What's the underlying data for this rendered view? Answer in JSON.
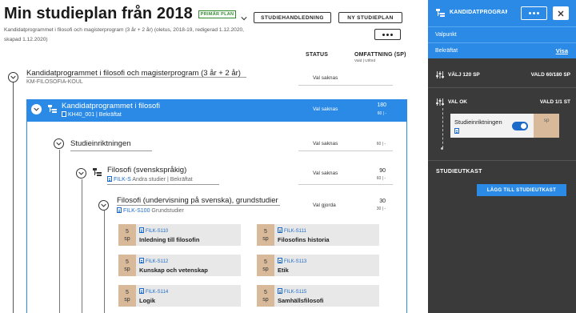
{
  "header": {
    "title": "Min studieplan från 2018",
    "badge": "PRIMÄR PLAN",
    "subtitle": "Kandidatprogrammet i filosofi och magisterprogram (3 år + 2 år) (oletus, 2018-19, redigerad 1.12.2020, skapad 1.12.2020)",
    "btn_guide": "STUDIEHANDLEDNING",
    "btn_new": "NY STUDIEPLAN"
  },
  "columns": {
    "status": "STATUS",
    "scope": "OMFATTNING (SP)",
    "scope_sub": "Vald | Utförd"
  },
  "tree": {
    "root": {
      "title": "Kandidatprogrammet i filosofi och magisterprogram (3 år + 2 år)",
      "code": "KM-FILOSOFIA-KOUL",
      "status": "Val saknas"
    },
    "prog": {
      "title": "Kandidatprogrammet i filosofi",
      "code": "KH40_001 | Bekräftat",
      "status": "Val saknas",
      "credits": "180",
      "credits_sub": "60 | -"
    },
    "line": {
      "title": "Studieinriktningen",
      "status": "Val saknas",
      "credits_sub": "60 | -"
    },
    "sub": {
      "title": "Filosofi (svenskspråkig)",
      "code": "FILK-S",
      "code_rest": "Andra studier | Bekräftat",
      "status": "Val saknas",
      "credits": "90",
      "credits_sub": "60 | -"
    },
    "basic": {
      "title": "Filosofi (undervisning på svenska), grundstudier",
      "code": "FILK-S100",
      "code_rest": "Grundstudier",
      "status": "Val gjorda",
      "credits": "30",
      "credits_sub": "30 | -"
    }
  },
  "courses": [
    {
      "sp": "5",
      "unit": "sp",
      "code": "FILK-S110",
      "name": "Inledning till filosofin"
    },
    {
      "sp": "5",
      "unit": "sp",
      "code": "FILK-S111",
      "name": "Filosofins historia"
    },
    {
      "sp": "5",
      "unit": "sp",
      "code": "FILK-S112",
      "name": "Kunskap och vetenskap"
    },
    {
      "sp": "5",
      "unit": "sp",
      "code": "FILK-S113",
      "name": "Etik"
    },
    {
      "sp": "5",
      "unit": "sp",
      "code": "FILK-S114",
      "name": "Logik"
    },
    {
      "sp": "5",
      "unit": "sp",
      "code": "FILK-S115",
      "name": "Samhällsfilosofi"
    }
  ],
  "side": {
    "title": "KANDIDATPROGRAMMET I FILOSOFI",
    "tab_choice": "Valpunkt",
    "tab_confirm": "Bekräftat",
    "tab_confirm_link": "Visa",
    "rule1_label": "VÄLJ 120 SP",
    "rule1_value": "VALD 60/180 SP",
    "rule2_label": "VAL OK",
    "rule2_value": "VALD 1/1 ST",
    "selected_name": "Studieinriktningen",
    "selected_sp": "sp",
    "section": "STUDIEUTKAST",
    "add_button": "LÄGG TILL STUDIEUTKAST"
  },
  "colors": {
    "accent": "#2a8ae6",
    "panel": "#3a3a3a",
    "credit_tag": "#d8b999",
    "primary_badge": "#2f8a2f"
  }
}
